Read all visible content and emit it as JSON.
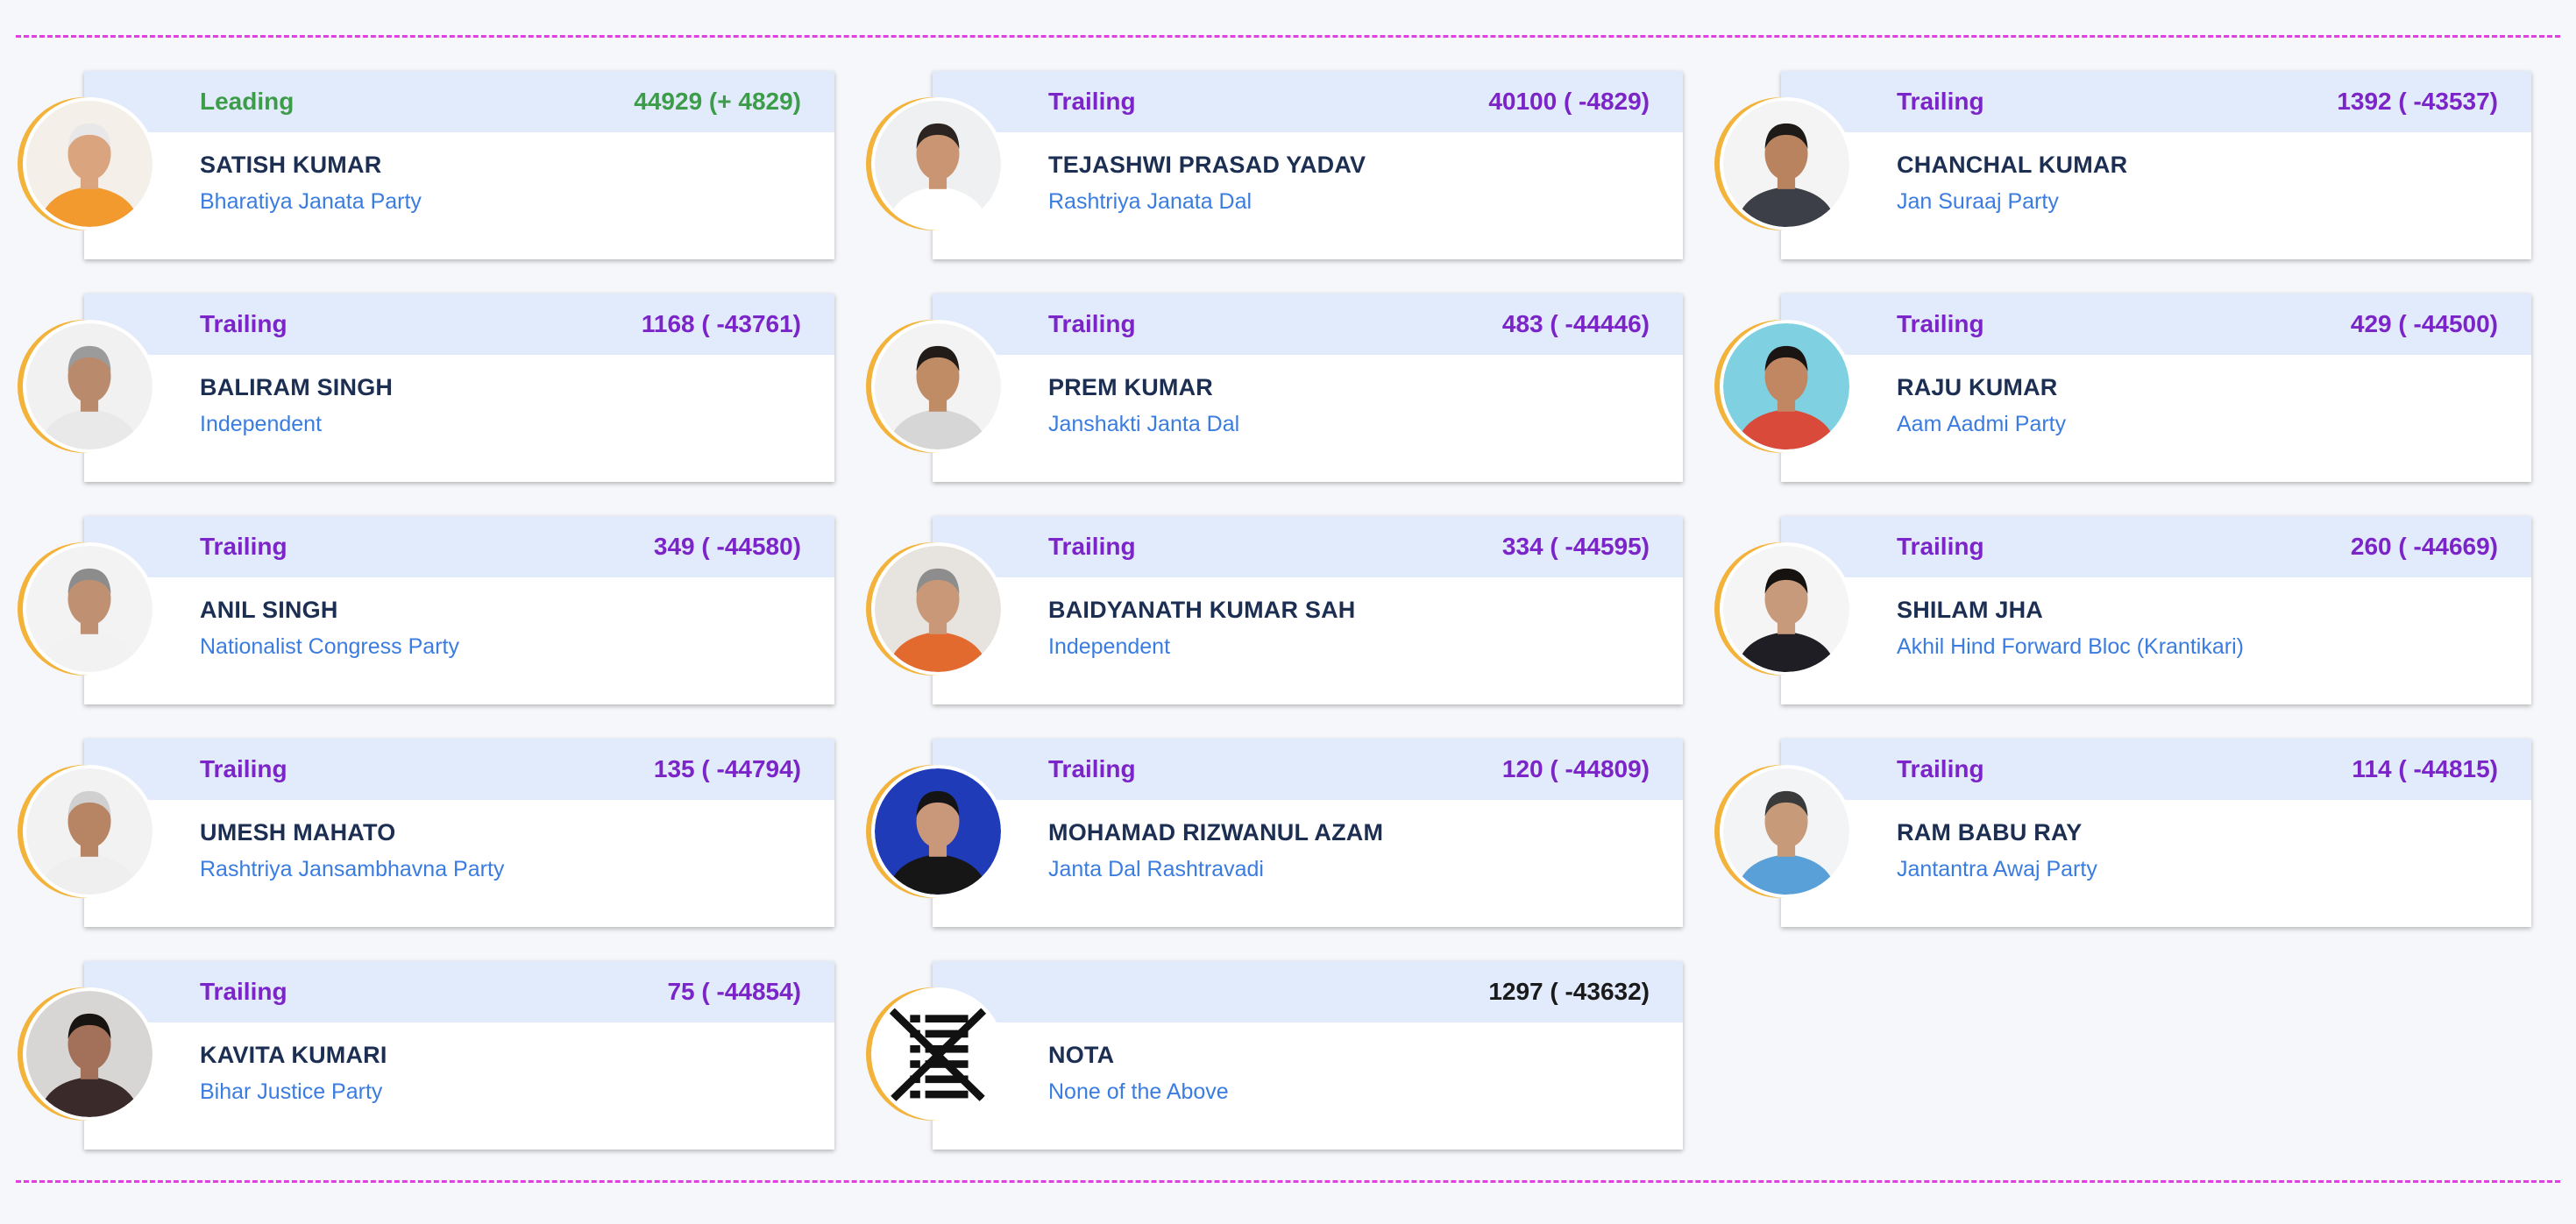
{
  "candidates": [
    {
      "status": "Leading",
      "votes": "44929 (+ 4829)",
      "name": "SATISH KUMAR",
      "party": "Bharatiya Janata Party",
      "bg": "#f5efe9",
      "skin": "#d9a47e",
      "hair": "#e8e8e8",
      "shirt": "#f29a2e"
    },
    {
      "status": "Trailing",
      "votes": "40100 ( -4829)",
      "name": "TEJASHWI PRASAD YADAV",
      "party": "Rashtriya Janata Dal",
      "bg": "#eef0f2",
      "skin": "#c99572",
      "hair": "#2b2420",
      "shirt": "#ffffff"
    },
    {
      "status": "Trailing",
      "votes": "1392 ( -43537)",
      "name": "CHANCHAL KUMAR",
      "party": "Jan Suraaj Party",
      "bg": "#f4f4f4",
      "skin": "#b9835f",
      "hair": "#1d1a18",
      "shirt": "#3c3e48"
    },
    {
      "status": "Trailing",
      "votes": "1168 ( -43761)",
      "name": "BALIRAM SINGH",
      "party": "Independent",
      "bg": "#f1f1f1",
      "skin": "#b98a6c",
      "hair": "#9b9b9b",
      "shirt": "#e9e9e9"
    },
    {
      "status": "Trailing",
      "votes": "483 ( -44446)",
      "name": "PREM KUMAR",
      "party": "Janshakti Janta Dal",
      "bg": "#f3f3f3",
      "skin": "#bf8c66",
      "hair": "#221c18",
      "shirt": "#d6d6d6"
    },
    {
      "status": "Trailing",
      "votes": "429 ( -44500)",
      "name": "RAJU KUMAR",
      "party": "Aam Aadmi Party",
      "bg": "#7fd0e0",
      "skin": "#c18763",
      "hair": "#1a1512",
      "shirt": "#d94a3a"
    },
    {
      "status": "Trailing",
      "votes": "349 ( -44580)",
      "name": "ANIL SINGH",
      "party": "Nationalist Congress Party",
      "bg": "#f3f3f3",
      "skin": "#c09072",
      "hair": "#8c8c8c",
      "shirt": "#f2f2f2"
    },
    {
      "status": "Trailing",
      "votes": "334 ( -44595)",
      "name": "BAIDYANATH KUMAR SAH",
      "party": "Independent",
      "bg": "#e7e3de",
      "skin": "#c89878",
      "hair": "#8d8d8d",
      "shirt": "#e26a2e"
    },
    {
      "status": "Trailing",
      "votes": "260 ( -44669)",
      "name": "SHILAM JHA",
      "party": "Akhil Hind Forward Bloc (Krantikari)",
      "bg": "#f5f5f5",
      "skin": "#c79a7c",
      "hair": "#151210",
      "shirt": "#1e1e24"
    },
    {
      "status": "Trailing",
      "votes": "135 ( -44794)",
      "name": "UMESH MAHATO",
      "party": "Rashtriya Jansambhavna Party",
      "bg": "#f2f2f2",
      "skin": "#b78464",
      "hair": "#d0d0d0",
      "shirt": "#efefef"
    },
    {
      "status": "Trailing",
      "votes": "120 ( -44809)",
      "name": "MOHAMAD RIZWANUL AZAM",
      "party": "Janta Dal Rashtravadi",
      "bg": "#1f3bb8",
      "skin": "#c9977a",
      "hair": "#141414",
      "shirt": "#161616"
    },
    {
      "status": "Trailing",
      "votes": "114 ( -44815)",
      "name": "RAM BABU RAY",
      "party": "Jantantra Awaj Party",
      "bg": "#f2f4f6",
      "skin": "#c79a7a",
      "hair": "#3a3a3a",
      "shirt": "#5aa0d8"
    },
    {
      "status": "Trailing",
      "votes": "75 ( -44854)",
      "name": "KAVITA KUMARI",
      "party": "Bihar Justice Party",
      "bg": "#d8d6d4",
      "skin": "#a3705a",
      "hair": "#181412",
      "shirt": "#3a2a2a"
    },
    {
      "status": "",
      "votes": "1297 ( -43632)",
      "name": "NOTA",
      "party": "None of the Above",
      "nota": true
    }
  ],
  "colors": {
    "leading": "#3d9c4a",
    "trailing": "#7b25c9",
    "name": "#1c2f53",
    "party": "#3a7ce0",
    "header_bg": "#e2ebfb",
    "avatar_ring": "#f3b23a",
    "divider": "#e23fe2"
  }
}
